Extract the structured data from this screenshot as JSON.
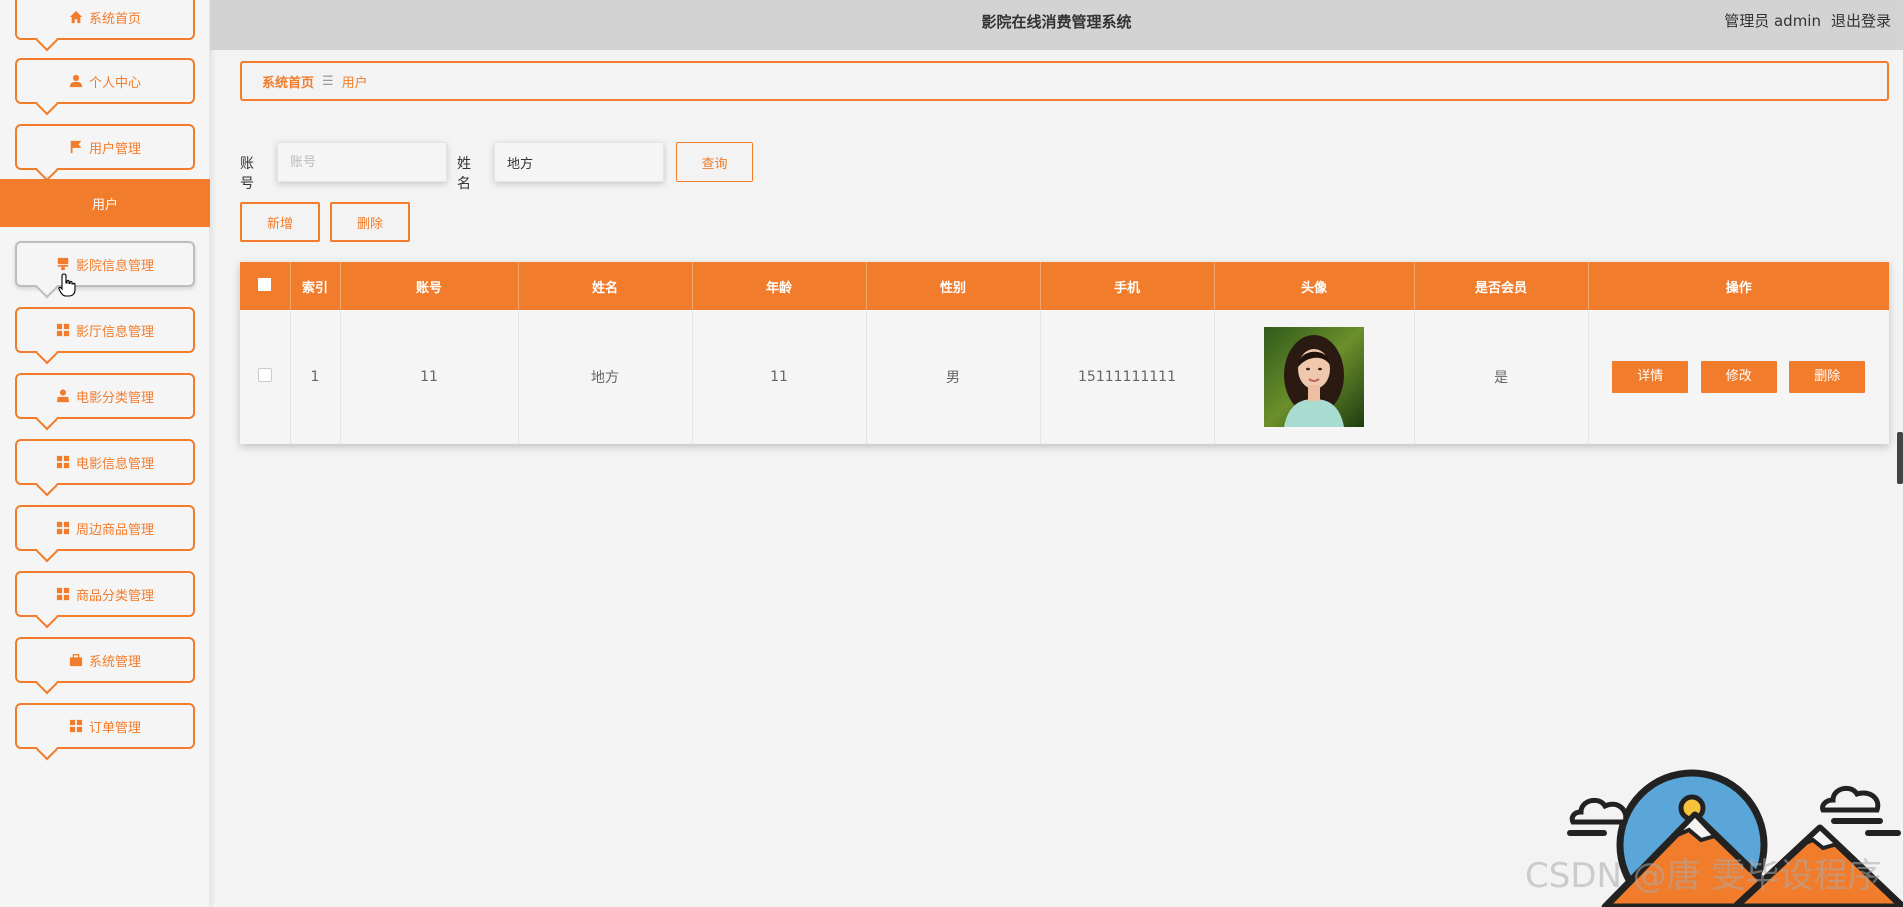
{
  "header": {
    "title": "影院在线消费管理系统",
    "role": "管理员",
    "username": "admin",
    "logout": "退出登录"
  },
  "sidebar": {
    "items": [
      {
        "label": "系统首页",
        "icon": "home-icon"
      },
      {
        "label": "个人中心",
        "icon": "user-icon"
      },
      {
        "label": "用户管理",
        "icon": "flag-icon"
      },
      {
        "label": "影院信息管理",
        "icon": "stamp-icon"
      },
      {
        "label": "影厅信息管理",
        "icon": "grid-icon"
      },
      {
        "label": "电影分类管理",
        "icon": "person-icon"
      },
      {
        "label": "电影信息管理",
        "icon": "grid-icon"
      },
      {
        "label": "周边商品管理",
        "icon": "grid-icon"
      },
      {
        "label": "商品分类管理",
        "icon": "grid-icon"
      },
      {
        "label": "系统管理",
        "icon": "briefcase-icon"
      },
      {
        "label": "订单管理",
        "icon": "grid-icon"
      }
    ],
    "active_sub": "用户"
  },
  "breadcrumb": {
    "home": "系统首页",
    "separator": "☰",
    "current": "用户"
  },
  "search": {
    "account_label": "账号",
    "account_placeholder": "账号",
    "account_value": "",
    "name_label": "姓名",
    "name_value": "地方",
    "query_button": "查询"
  },
  "actions": {
    "add_button": "新增",
    "delete_button": "删除"
  },
  "table": {
    "headers": [
      "索引",
      "账号",
      "姓名",
      "年龄",
      "性别",
      "手机",
      "头像",
      "是否会员",
      "操作"
    ],
    "rows": [
      {
        "index": "1",
        "account": "11",
        "name": "地方",
        "age": "11",
        "gender": "男",
        "phone": "15111111111",
        "member": "是",
        "ops": [
          "详情",
          "修改",
          "删除"
        ]
      }
    ]
  },
  "watermark": "CSDN @唐 雯毕设程序",
  "colors": {
    "accent": "#f17c2b",
    "header_bg": "#d3d3d3",
    "page_bg": "#f3f3f3"
  }
}
